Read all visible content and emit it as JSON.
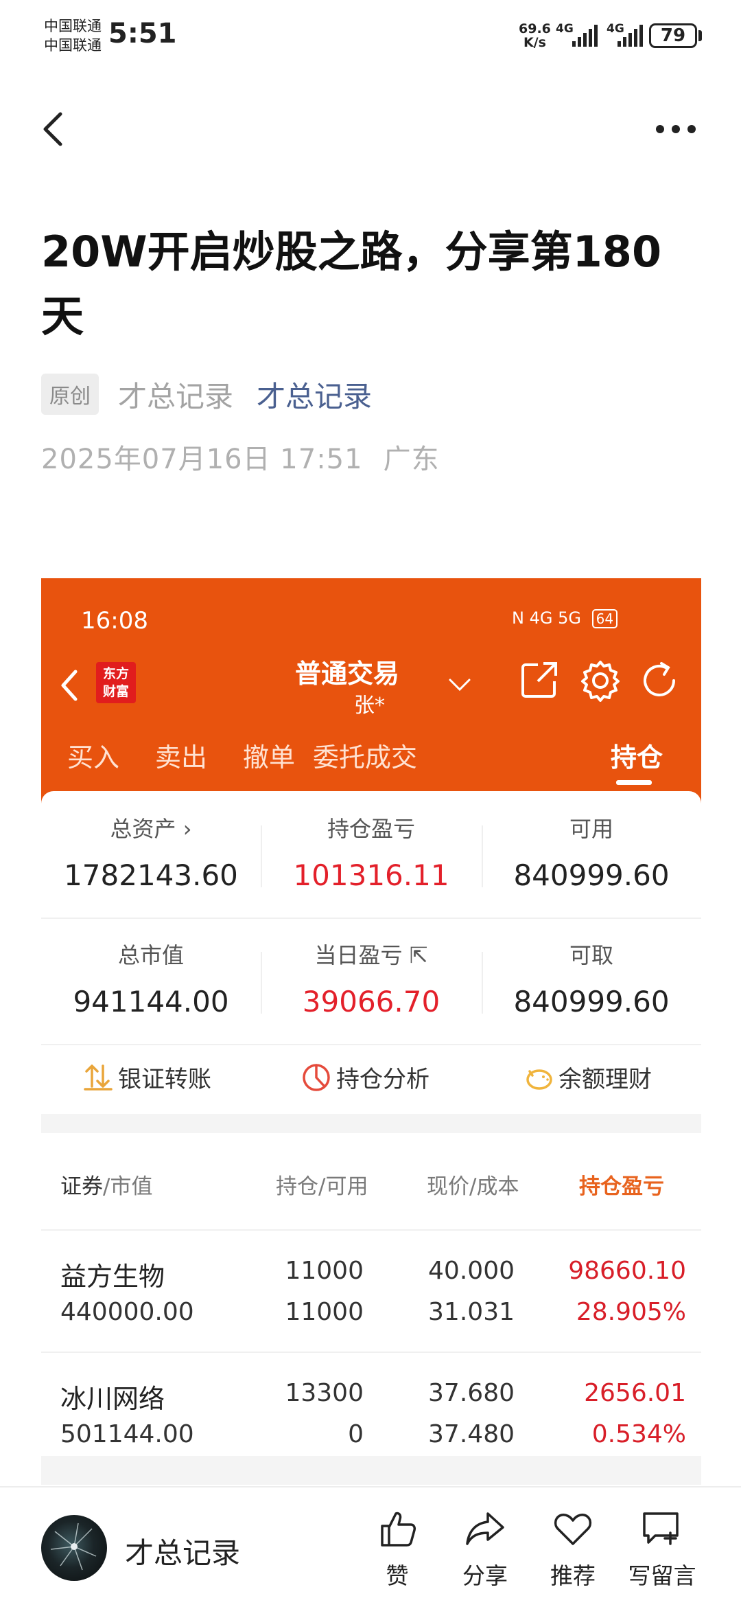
{
  "status_bar": {
    "carrier_1": "中国联通",
    "carrier_2": "中国联通",
    "time": "5:51",
    "net_speed_value": "69.6",
    "net_speed_unit": "K/s",
    "signal_1_type": "4G",
    "signal_2_type": "4G",
    "battery": "79"
  },
  "article": {
    "title": "20W开启炒股之路，分享第180天",
    "original_badge": "原创",
    "author_plain": "才总记录",
    "author_link": "才总记录",
    "date": "2025年07月16日 17:51",
    "location": "广东"
  },
  "screenshot": {
    "time": "16:08",
    "status_icons": "N 4G 5G",
    "battery": "64",
    "logo_line1": "东方",
    "logo_line2": "财富",
    "title": "普通交易",
    "account": "张*",
    "tabs": [
      "买入",
      "卖出",
      "撤单",
      "委托成交",
      "持仓"
    ],
    "active_tab": "持仓",
    "summary": {
      "total_assets_label": "总资产",
      "total_assets": "1782143.60",
      "position_pl_label": "持仓盈亏",
      "position_pl": "101316.11",
      "available_label": "可用",
      "available": "840999.60",
      "market_value_label": "总市值",
      "market_value": "941144.00",
      "daily_pl_label": "当日盈亏",
      "daily_pl": "39066.70",
      "withdrawable_label": "可取",
      "withdrawable": "840999.60"
    },
    "quick_actions": [
      "银证转账",
      "持仓分析",
      "余额理财"
    ],
    "table": {
      "col1_main": "证券",
      "col1_sub": "/市值",
      "col2": "持仓/可用",
      "col3": "现价/成本",
      "col4": "持仓盈亏",
      "rows": [
        {
          "name": "益方生物",
          "market_value": "440000.00",
          "holding": "11000",
          "available": "11000",
          "price": "40.000",
          "cost": "31.031",
          "pl": "98660.10",
          "pl_pct": "28.905%"
        },
        {
          "name": "冰川网络",
          "market_value": "501144.00",
          "holding": "13300",
          "available": "0",
          "price": "37.680",
          "cost": "37.480",
          "pl": "2656.01",
          "pl_pct": "0.534%"
        }
      ]
    }
  },
  "bottom_bar": {
    "author": "才总记录",
    "like": "赞",
    "share": "分享",
    "recommend": "推荐",
    "comment": "写留言"
  },
  "colors": {
    "app_orange": "#e8530e",
    "profit_red": "#d81e28",
    "link_blue": "#4a6090",
    "active_header": "#e8631e"
  }
}
